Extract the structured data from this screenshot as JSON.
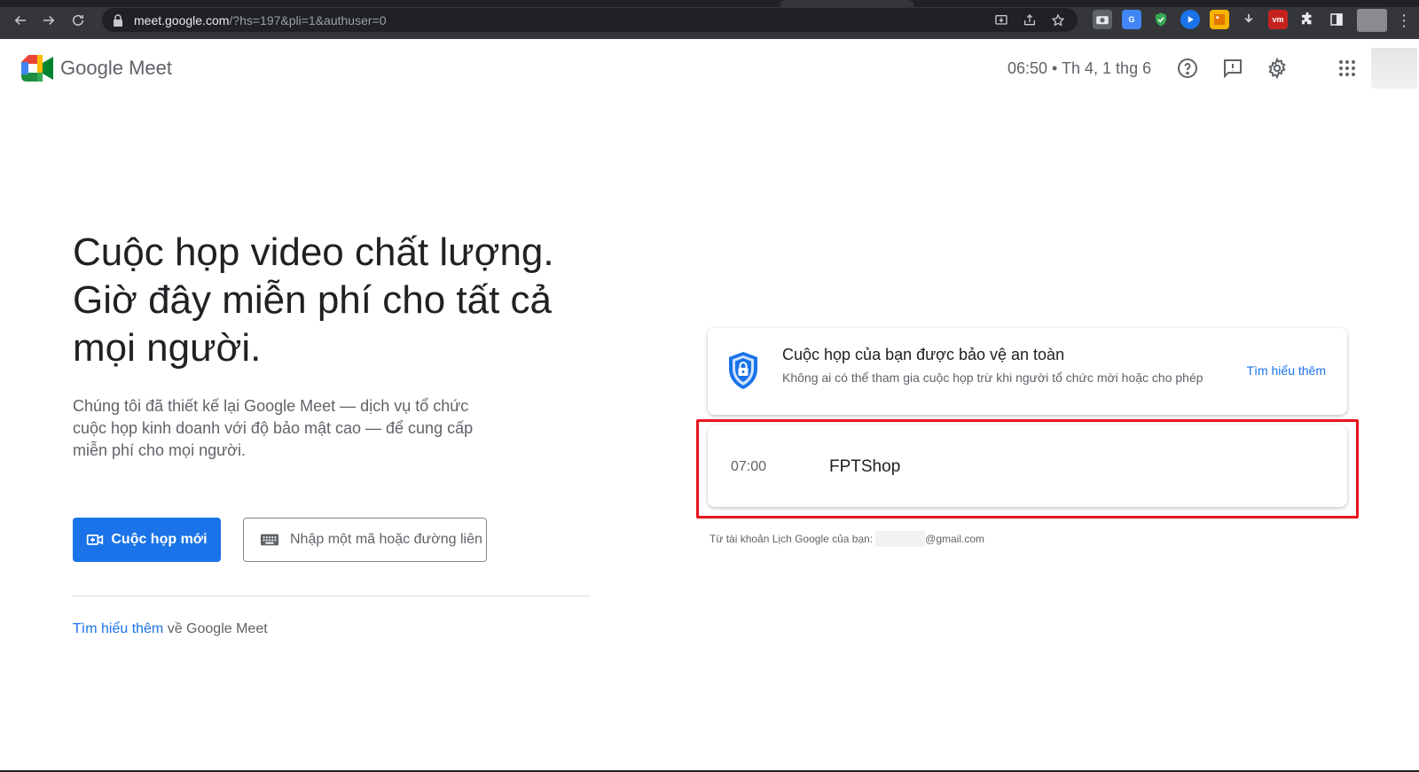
{
  "browser": {
    "url_main": "meet.google.com",
    "url_rest": "/?hs=197&pli=1&authuser=0",
    "extension_icons": [
      "camera-icon",
      "translate-icon",
      "shield-check-icon",
      "play-icon",
      "image-icon",
      "download-icon",
      "vm-icon",
      "puzzle-icon",
      "sidebar-icon"
    ]
  },
  "header": {
    "brand_google": "Google",
    "brand_product": "Meet",
    "clock": "06:50 • Th 4, 1 thg 6"
  },
  "hero": {
    "title": "Cuộc họp video chất lượng. Giờ đây miễn phí cho tất cả mọi người.",
    "subtitle": "Chúng tôi đã thiết kế lại Google Meet — dịch vụ tổ chức cuộc họp kinh doanh với độ bảo mật cao — để cung cấp miễn phí cho mọi người.",
    "new_meeting_label": "Cuộc họp mới",
    "join_placeholder": "Nhập một mã hoặc đường liên kết",
    "learn_more_link": "Tìm hiểu thêm",
    "learn_more_suffix": " về Google Meet"
  },
  "secure_card": {
    "title": "Cuộc họp của bạn được bảo vệ an toàn",
    "description": "Không ai có thể tham gia cuộc họp trừ khi người tổ chức mời hoặc cho phép",
    "link": "Tìm hiểu thêm"
  },
  "event": {
    "time": "07:00",
    "name": "FPTShop"
  },
  "account": {
    "prefix": "Từ tài khoản Lịch Google của bạn:",
    "email_suffix": "@gmail.com"
  },
  "colors": {
    "primary": "#1a73e8",
    "highlight": "#e8141c",
    "chrome_bg": "#35363a"
  }
}
